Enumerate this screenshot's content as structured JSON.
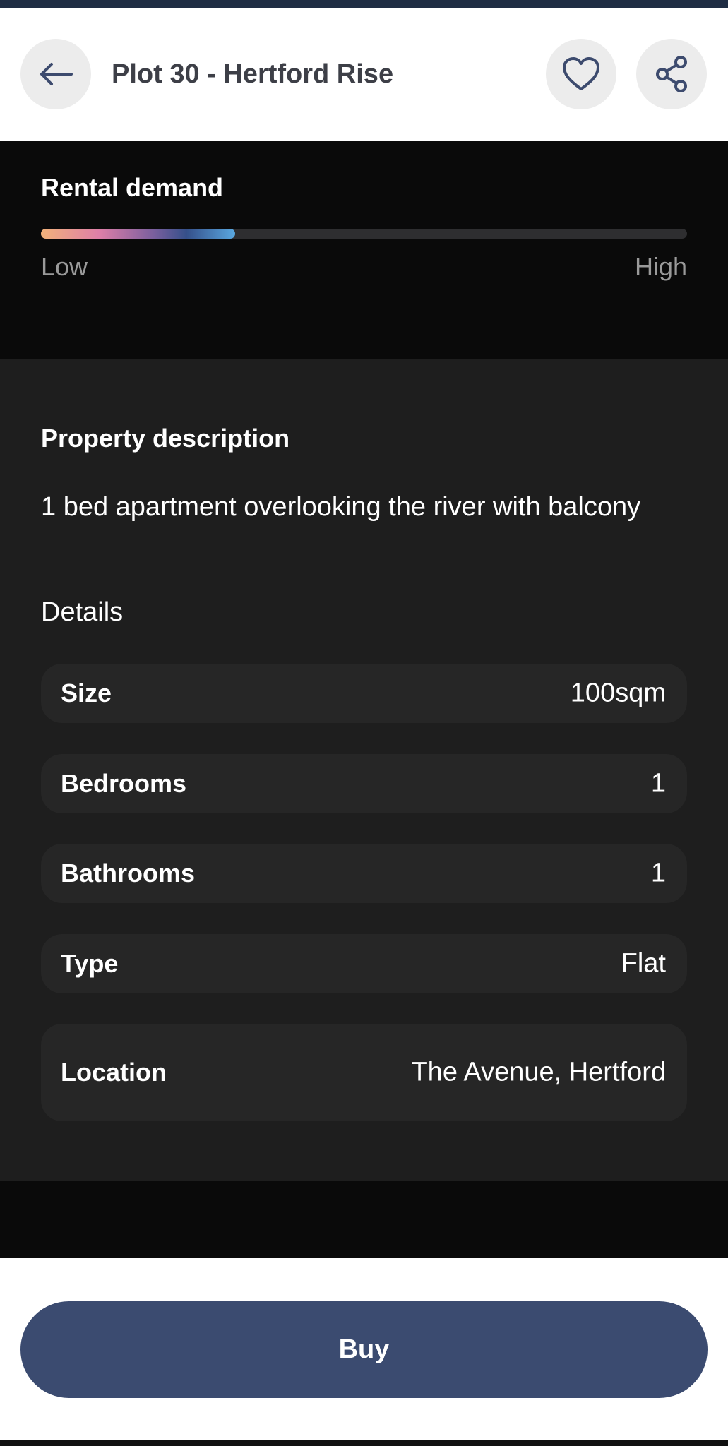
{
  "header": {
    "title": "Plot 30 - Hertford Rise",
    "back_icon": "arrow-left-icon",
    "favorite_icon": "heart-icon",
    "share_icon": "share-icon",
    "icon_color": "#3d4b6e"
  },
  "rental_demand": {
    "title": "Rental demand",
    "low_label": "Low",
    "high_label": "High",
    "level_fraction": 0.3
  },
  "description": {
    "title": "Property description",
    "text": "1 bed apartment overlooking the river with balcony"
  },
  "details": {
    "heading": "Details",
    "rows": [
      {
        "label": "Size",
        "value": "100sqm"
      },
      {
        "label": "Bedrooms",
        "value": "1"
      },
      {
        "label": "Bathrooms",
        "value": "1"
      },
      {
        "label": "Type",
        "value": "Flat"
      },
      {
        "label": "Location",
        "value": "The Avenue, Hertford"
      }
    ]
  },
  "footer": {
    "buy_label": "Buy",
    "buy_color": "#3b4b70"
  }
}
